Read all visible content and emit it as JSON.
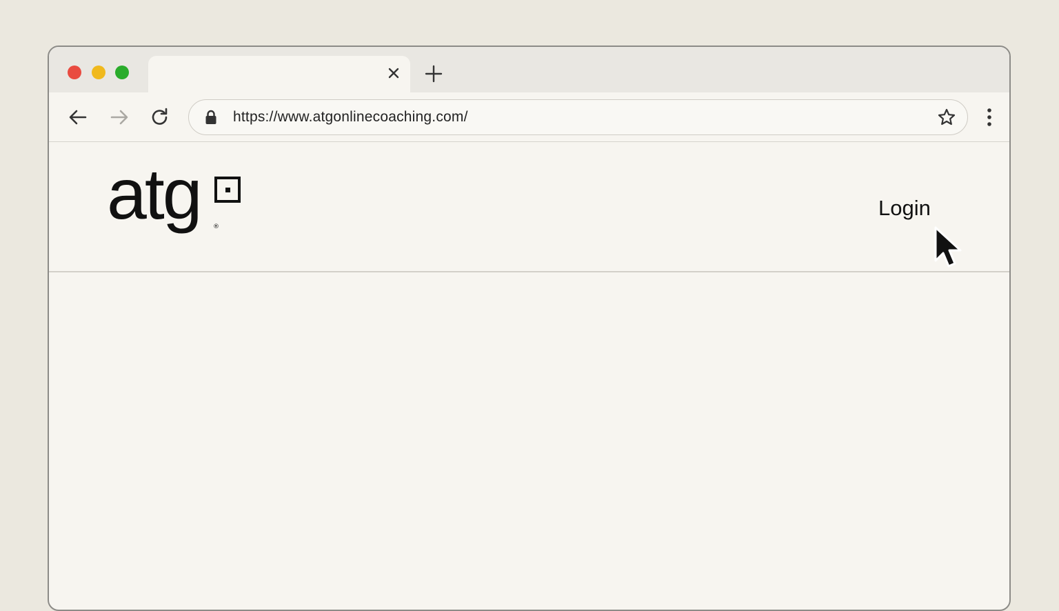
{
  "browser": {
    "tab": {
      "title": "",
      "close_icon": "close-icon"
    },
    "new_tab_icon": "plus-icon",
    "controls": {
      "traffic_lights": [
        "#e94b40",
        "#f0b91d",
        "#2aac2b"
      ],
      "back_icon": "arrow-left-icon",
      "forward_icon": "arrow-right-icon",
      "reload_icon": "reload-icon"
    },
    "address_bar": {
      "url": "https://www.atgonlinecoaching.com/",
      "lock_icon": "lock-icon",
      "bookmark_icon": "star-icon"
    },
    "menu_icon": "kebab-menu-icon"
  },
  "site": {
    "logo": {
      "text": "atg",
      "mark": "®"
    },
    "nav": {
      "login_label": "Login"
    }
  },
  "pointer": {
    "icon": "mouse-pointer-icon"
  }
}
